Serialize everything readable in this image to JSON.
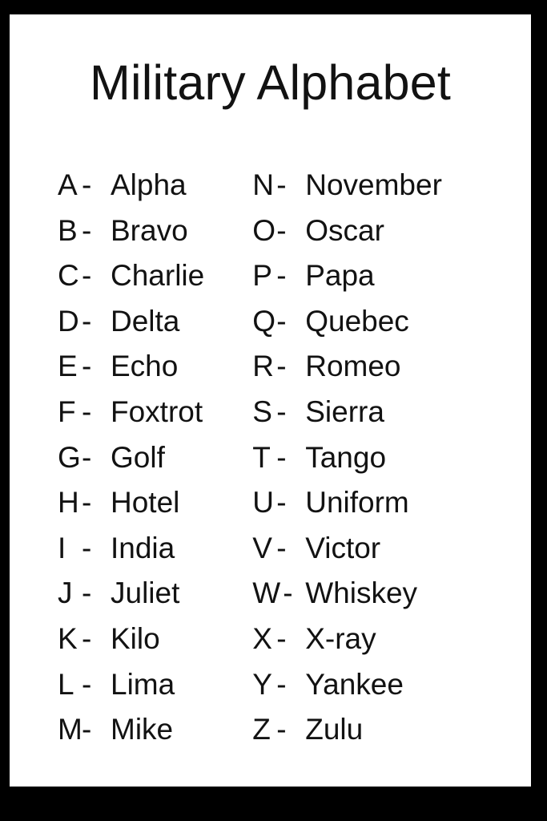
{
  "poster": {
    "title": "Military Alphabet",
    "frame_color": "#000000",
    "card_color": "#ffffff",
    "text_color": "#121212",
    "separator": "-"
  },
  "columns": {
    "left": [
      {
        "letter": "A",
        "dash": "-",
        "word": "Alpha"
      },
      {
        "letter": "B",
        "dash": "-",
        "word": "Bravo"
      },
      {
        "letter": "C",
        "dash": "-",
        "word": "Charlie"
      },
      {
        "letter": "D",
        "dash": "-",
        "word": "Delta"
      },
      {
        "letter": "E",
        "dash": "-",
        "word": "Echo"
      },
      {
        "letter": "F",
        "dash": "-",
        "word": "Foxtrot"
      },
      {
        "letter": "G",
        "dash": "-",
        "word": "Golf"
      },
      {
        "letter": "H",
        "dash": "-",
        "word": "Hotel"
      },
      {
        "letter": "I",
        "dash": "-",
        "word": "India"
      },
      {
        "letter": "J",
        "dash": "-",
        "word": "Juliet"
      },
      {
        "letter": "K",
        "dash": "-",
        "word": "Kilo"
      },
      {
        "letter": "L",
        "dash": "-",
        "word": "Lima"
      },
      {
        "letter": "M",
        "dash": "-",
        "word": "Mike"
      }
    ],
    "right": [
      {
        "letter": "N",
        "dash": "-",
        "word": "November"
      },
      {
        "letter": "O",
        "dash": "-",
        "word": "Oscar"
      },
      {
        "letter": "P",
        "dash": "-",
        "word": "Papa"
      },
      {
        "letter": "Q",
        "dash": "-",
        "word": "Quebec"
      },
      {
        "letter": "R",
        "dash": "-",
        "word": "Romeo"
      },
      {
        "letter": "S",
        "dash": "-",
        "word": "Sierra"
      },
      {
        "letter": "T",
        "dash": "-",
        "word": "Tango"
      },
      {
        "letter": "U",
        "dash": "-",
        "word": "Uniform"
      },
      {
        "letter": "V",
        "dash": "-",
        "word": "Victor"
      },
      {
        "letter": "W",
        "dash": "-",
        "word": "Whiskey"
      },
      {
        "letter": "X",
        "dash": "-",
        "word": "X-ray"
      },
      {
        "letter": "Y",
        "dash": "-",
        "word": "Yankee"
      },
      {
        "letter": "Z",
        "dash": "-",
        "word": "Zulu"
      }
    ]
  }
}
